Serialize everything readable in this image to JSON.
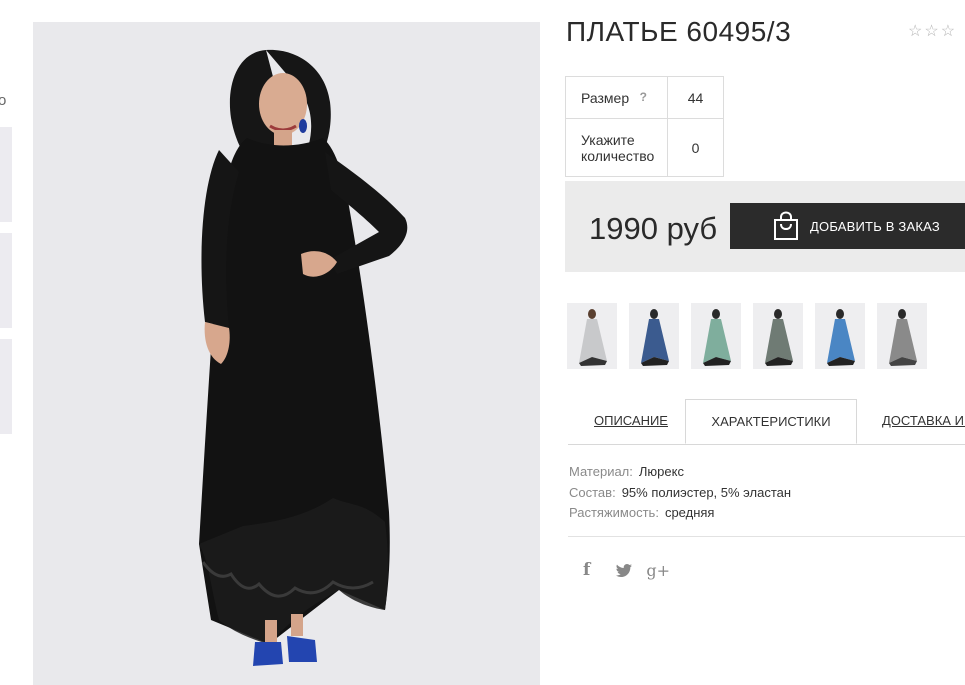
{
  "product": {
    "title": "ПЛАТЬЕ 60495/3",
    "rating_stars": [
      "☆",
      "☆",
      "☆"
    ],
    "rating_value": 0
  },
  "options": {
    "size_label": "Размер",
    "size_help": "?",
    "size_value": "44",
    "qty_label": "Укажите количество",
    "qty_value": "0"
  },
  "purchase": {
    "price": "1990 руб",
    "add_button": "ДОБАВИТЬ В ЗАКАЗ"
  },
  "colors": {
    "brand_dark": "#2b2b2b",
    "panel_bg": "#ebebeb",
    "variants": [
      "#c8c9cb",
      "#3b5b8f",
      "#7fae9d",
      "#6f7b74",
      "#4a86c4",
      "#8a8a8a"
    ]
  },
  "tabs": [
    {
      "label": "ОПИСАНИЕ"
    },
    {
      "label": "ХАРАКТЕРИСТИКИ"
    },
    {
      "label": "ДОСТАВКА И О"
    }
  ],
  "active_tab": "ХАРАКТЕРИСТИКИ",
  "specs": [
    {
      "key": "Материал:",
      "value": "Люрекс"
    },
    {
      "key": "Состав:",
      "value": "95% полиэстер, 5% эластан"
    },
    {
      "key": "Растяжимость:",
      "value": "средняя"
    }
  ],
  "social": {
    "facebook": "f",
    "twitter_icon": "twitter-icon",
    "googleplus": "g+"
  },
  "left_edge_fragment": "о"
}
